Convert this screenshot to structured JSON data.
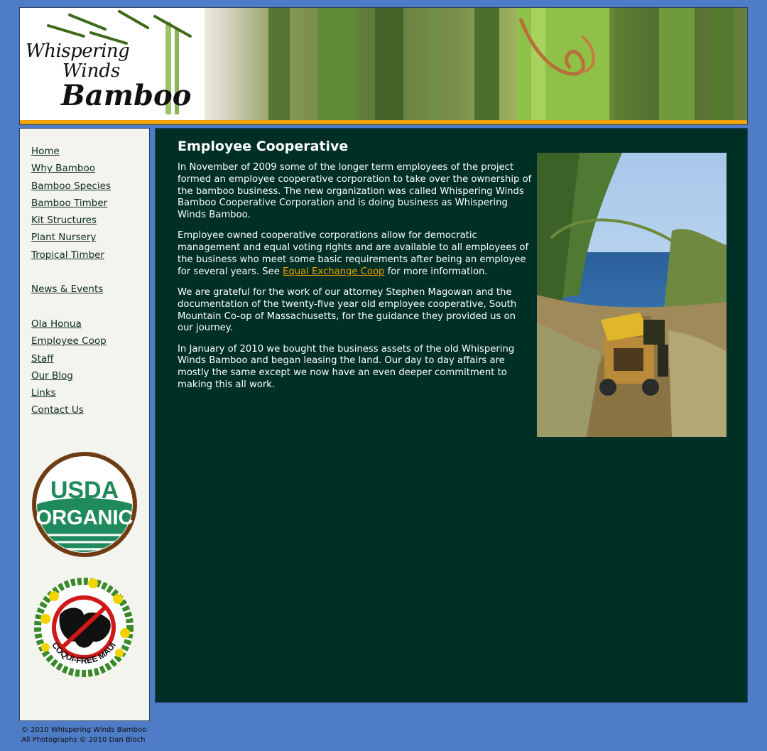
{
  "site": {
    "logo": {
      "line1": "Whispering",
      "line2": "Winds",
      "line3": "Bamboo"
    }
  },
  "nav": {
    "group1": [
      "Home",
      "Why Bamboo",
      "Bamboo Species",
      "Bamboo Timber",
      "Kit Structures",
      "Plant Nursery",
      "Tropical Timber"
    ],
    "group2": [
      "News & Events"
    ],
    "group3": [
      "Ola Honua",
      "Employee Coop",
      "Staff",
      "Our Blog",
      "Links",
      "Contact Us"
    ]
  },
  "badges": {
    "usda": {
      "line1": "USDA",
      "line2": "ORGANIC"
    },
    "coqui": {
      "ring": "COQUI-FREE MAUI"
    }
  },
  "content": {
    "title": "Employee Cooperative",
    "p1": "In November of 2009 some of the longer term employees of the project formed an employee cooperative corporation to take over the ownership of the bamboo business. The new organization was called Whispering Winds Bamboo Cooperative Corporation and is doing business as Whispering Winds Bamboo.",
    "p2_before": "Employee owned cooperative corporations allow for democratic management and equal voting rights and are available to all employees of the business who meet some basic requirements after being an employee for several years. See ",
    "p2_link": "Equal Exchange Coop",
    "p2_after": " for more information.",
    "p3": "We are grateful for the work of our attorney Stephen Magowan and the documentation of the twenty-five year old employee cooperative, South Mountain Co-op of Massachusetts, for the guidance they provided us on our journey.",
    "p4": "In January of 2010 we bought the business assets of the old Whispering Winds Bamboo and began leasing the land. Our day to day affairs are mostly the same except we now have an even deeper commitment to making this all work."
  },
  "footer": {
    "line1": "© 2010 Whispering Winds Bamboo",
    "line2": "All Photographs © 2010 Dan Bloch"
  },
  "colors": {
    "page_background": "#4f7cc6",
    "content_background": "#003025",
    "sidebar_background": "#f4f4ee",
    "accent_orange": "#f2a200",
    "link_color": "#f2a000"
  }
}
